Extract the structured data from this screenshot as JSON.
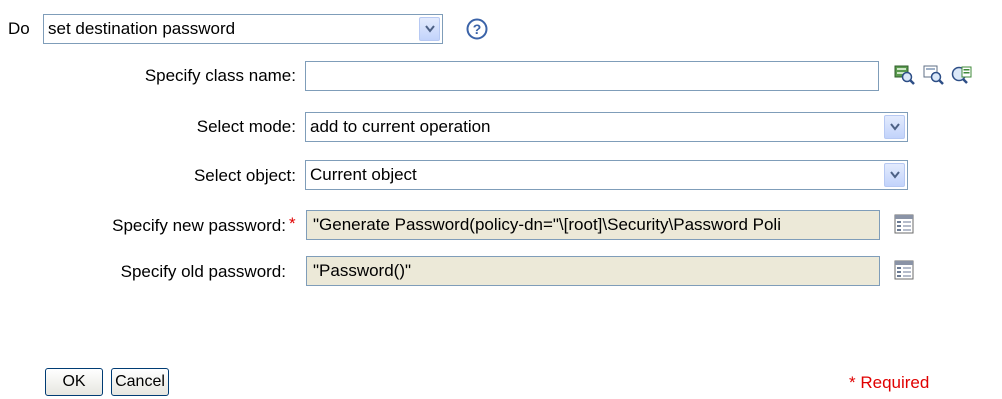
{
  "do_label": "Do",
  "action": {
    "selected": "set destination password"
  },
  "help": {
    "symbol": "?"
  },
  "fields": {
    "class_name": {
      "label": "Specify class name:",
      "value": ""
    },
    "mode": {
      "label": "Select mode:",
      "selected": "add to current operation"
    },
    "object": {
      "label": "Select object:",
      "selected": "Current object"
    },
    "new_password": {
      "label": "Specify new password:",
      "required_marker": "*",
      "value": "\"Generate Password(policy-dn=\"\\[root]\\Security\\Password Poli"
    },
    "old_password": {
      "label": "Specify old password:",
      "value": "\"Password()\""
    }
  },
  "buttons": {
    "ok": "OK",
    "cancel": "Cancel"
  },
  "footer": {
    "required_note": "* Required"
  },
  "colors": {
    "required": "#e00000",
    "border": "#7f9db9",
    "readonly_bg": "#ece9d8"
  }
}
